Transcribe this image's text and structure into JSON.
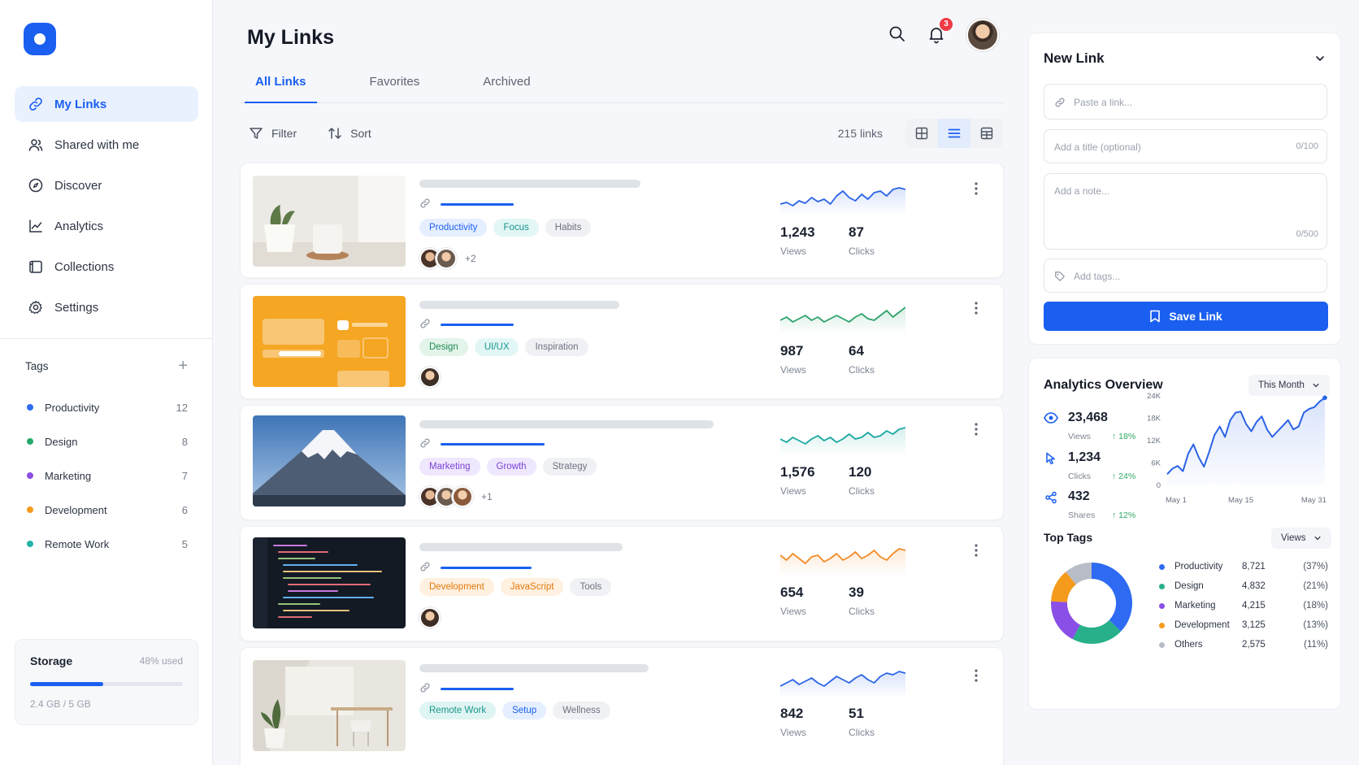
{
  "sidebar": {
    "nav": [
      {
        "label": "My Links",
        "icon": "link-icon",
        "active": true
      },
      {
        "label": "Shared with me",
        "icon": "users-icon"
      },
      {
        "label": "Discover",
        "icon": "compass-icon"
      },
      {
        "label": "Analytics",
        "icon": "chart-icon"
      },
      {
        "label": "Collections",
        "icon": "folder-icon"
      },
      {
        "label": "Settings",
        "icon": "gear-icon"
      }
    ],
    "tags_title": "Tags",
    "tags": [
      {
        "label": "Productivity",
        "count": "12",
        "color": "#2f6bf2"
      },
      {
        "label": "Design",
        "count": "8",
        "color": "#27a86b"
      },
      {
        "label": "Marketing",
        "count": "7",
        "color": "#8a4fe6"
      },
      {
        "label": "Development",
        "count": "6",
        "color": "#f59b1c"
      },
      {
        "label": "Remote Work",
        "count": "5",
        "color": "#23b3a8"
      }
    ],
    "storage": {
      "title": "Storage",
      "used_label": "48% used",
      "used_fraction": 0.48,
      "text": "2.4 GB / 5 GB"
    }
  },
  "header": {
    "title": "My Links",
    "notification_count": "3"
  },
  "tabs": [
    "All Links",
    "Favorites",
    "Archived"
  ],
  "toolbar": {
    "filter": "Filter",
    "sort": "Sort",
    "count": "215 links"
  },
  "links": [
    {
      "views": "1,243",
      "clicks": "87",
      "views_label": "Views",
      "clicks_label": "Clicks",
      "tags": [
        {
          "label": "Productivity",
          "bg": "#e6efff",
          "fg": "#1a5ff0"
        },
        {
          "label": "Focus",
          "bg": "#e2f6f5",
          "fg": "#17958c"
        },
        {
          "label": "Habits",
          "bg": "#f0f1f4",
          "fg": "#6b7280"
        }
      ],
      "more": "+2",
      "spark_color": "#2a63e6"
    },
    {
      "views": "987",
      "clicks": "64",
      "views_label": "Views",
      "clicks_label": "Clicks",
      "tags": [
        {
          "label": "Design",
          "bg": "#e3f5ea",
          "fg": "#1f8a52"
        },
        {
          "label": "UI/UX",
          "bg": "#e2f6f5",
          "fg": "#17958c"
        },
        {
          "label": "Inspiration",
          "bg": "#f0f1f4",
          "fg": "#6b7280"
        }
      ],
      "more": "",
      "spark_color": "#2ca36a"
    },
    {
      "views": "1,576",
      "clicks": "120",
      "views_label": "Views",
      "clicks_label": "Clicks",
      "tags": [
        {
          "label": "Marketing",
          "bg": "#efe7fd",
          "fg": "#7a42d8"
        },
        {
          "label": "Growth",
          "bg": "#efe7fd",
          "fg": "#7a42d8"
        },
        {
          "label": "Strategy",
          "bg": "#f0f1f4",
          "fg": "#6b7280"
        }
      ],
      "more": "+1",
      "spark_color": "#1aa7a0"
    },
    {
      "views": "654",
      "clicks": "39",
      "views_label": "Views",
      "clicks_label": "Clicks",
      "tags": [
        {
          "label": "Development",
          "bg": "#fff0df",
          "fg": "#e3780b"
        },
        {
          "label": "JavaScript",
          "bg": "#fff0df",
          "fg": "#e3780b"
        },
        {
          "label": "Tools",
          "bg": "#f0f1f4",
          "fg": "#6b7280"
        }
      ],
      "more": "",
      "spark_color": "#f28b25"
    },
    {
      "views": "842",
      "clicks": "51",
      "views_label": "Views",
      "clicks_label": "Clicks",
      "tags": [
        {
          "label": "Remote Work",
          "bg": "#dff5f3",
          "fg": "#17958c"
        },
        {
          "label": "Setup",
          "bg": "#e6efff",
          "fg": "#1a5ff0"
        },
        {
          "label": "Wellness",
          "bg": "#f0f1f4",
          "fg": "#6b7280"
        }
      ],
      "more": "",
      "spark_color": "#2a63e6"
    }
  ],
  "new_link": {
    "title": "New Link",
    "paste_placeholder": "Paste a link...",
    "title_placeholder": "Add a title (optional)",
    "title_counter": "0/100",
    "note_placeholder": "Add a note...",
    "note_counter": "0/500",
    "tags_placeholder": "Add tags...",
    "save_label": "Save Link"
  },
  "analytics": {
    "title": "Analytics Overview",
    "period": "This Month",
    "metrics": [
      {
        "value": "23,468",
        "label": "Views",
        "change": "↑ 18%",
        "icon": "eye-icon"
      },
      {
        "value": "1,234",
        "label": "Clicks",
        "change": "↑ 24%",
        "icon": "cursor-icon"
      },
      {
        "value": "432",
        "label": "Shares",
        "change": "↑ 12%",
        "icon": "share-icon"
      }
    ]
  },
  "top_tags": {
    "title": "Top Tags",
    "metric": "Views",
    "items": [
      {
        "label": "Productivity",
        "value": "8,721",
        "pct": "(37%)",
        "color": "#2f6bf2"
      },
      {
        "label": "Design",
        "value": "4,832",
        "pct": "(21%)",
        "color": "#27b08a"
      },
      {
        "label": "Marketing",
        "value": "4,215",
        "pct": "(18%)",
        "color": "#8a4fe6"
      },
      {
        "label": "Development",
        "value": "3,125",
        "pct": "(13%)",
        "color": "#f59b1c"
      },
      {
        "label": "Others",
        "value": "2,575",
        "pct": "(11%)",
        "color": "#b7bcc6"
      }
    ]
  },
  "chart_data": [
    {
      "type": "area",
      "title": "",
      "x_ticks": [
        "May 1",
        "May 15",
        "May 31"
      ],
      "y_ticks": [
        "0",
        "6K",
        "12K",
        "18K",
        "24K"
      ],
      "ylim": [
        0,
        24000
      ],
      "x": [
        1,
        2,
        3,
        4,
        5,
        6,
        7,
        8,
        9,
        10,
        11,
        12,
        13,
        14,
        15,
        16,
        17,
        18,
        19,
        20,
        21,
        22,
        23,
        24,
        25,
        26,
        27,
        28,
        29,
        30,
        31
      ],
      "series": [
        {
          "values": [
            3000,
            4500,
            5200,
            3800,
            8500,
            11000,
            7500,
            5000,
            9000,
            13500,
            15800,
            13000,
            17500,
            19500,
            19800,
            16500,
            14500,
            17000,
            18500,
            15000,
            13000,
            14500,
            16000,
            17500,
            15000,
            15800,
            19500,
            20500,
            21000,
            22500,
            23500
          ]
        }
      ],
      "grid": false,
      "color": "#2a63e6"
    },
    {
      "type": "pie",
      "title": "",
      "categories": [
        "Productivity",
        "Design",
        "Marketing",
        "Development",
        "Others"
      ],
      "values": [
        8721,
        4832,
        4215,
        3125,
        2575
      ],
      "colors": [
        "#2f6bf2",
        "#27b08a",
        "#8a4fe6",
        "#f59b1c",
        "#b7bcc6"
      ],
      "donut": true
    }
  ]
}
